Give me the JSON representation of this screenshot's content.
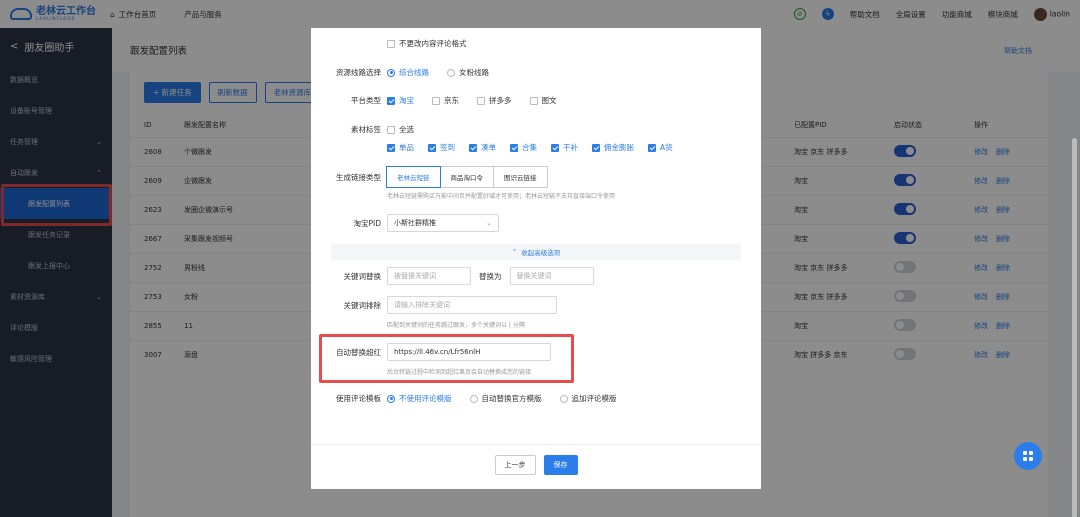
{
  "topbar": {
    "logo_main": "老林云工作台",
    "logo_sub": "LAOLINCLOUD",
    "nav_home": "工作台首页",
    "nav_products": "产品与服务",
    "help_docs": "帮助文档",
    "global_settings": "全局设置",
    "feature_mall": "功能商城",
    "module_mall": "模块商城",
    "username": "laolin"
  },
  "sidebar": {
    "title": "朋友圈助手",
    "items": [
      {
        "label": "数据概览"
      },
      {
        "label": "设备账号管理"
      },
      {
        "label": "任务管理",
        "arrow": "⌄"
      },
      {
        "label": "自动跟发",
        "arrow": "⌃"
      },
      {
        "label": "跟发配置列表"
      },
      {
        "label": "跟发任务记录"
      },
      {
        "label": "跟发上报中心"
      },
      {
        "label": "素材资源库",
        "arrow": "⌄"
      },
      {
        "label": "评论模版"
      },
      {
        "label": "敏感风险管理"
      }
    ]
  },
  "main": {
    "title": "跟发配置列表",
    "help": "帮助文档",
    "buttons": {
      "new_task": "+ 新建任务",
      "refresh": "刷新数据",
      "laolin": "老林资源库"
    },
    "table": {
      "headers": [
        "ID",
        "跟发配置名称",
        "",
        "已配置PID",
        "启动状态",
        "操作"
      ],
      "rows": [
        {
          "id": "2608",
          "name": "个微跟发",
          "pid": "淘宝 京东 拼多多",
          "on": true
        },
        {
          "id": "2609",
          "name": "企微跟发",
          "pid": "淘宝",
          "on": true
        },
        {
          "id": "2623",
          "name": "发圈企微演示号",
          "pid": "淘宝",
          "on": true
        },
        {
          "id": "2667",
          "name": "采集跟发视频号",
          "pid": "淘宝",
          "on": true
        },
        {
          "id": "2752",
          "name": "男粉线",
          "pid": "淘宝 京东 拼多多",
          "on": false
        },
        {
          "id": "2753",
          "name": "女粉",
          "pid": "淘宝 京东 拼多多",
          "on": false
        },
        {
          "id": "2855",
          "name": "11",
          "pid": "淘宝",
          "on": false
        },
        {
          "id": "3007",
          "name": "源盘",
          "pid": "淘宝 拼多多 京东",
          "on": false
        }
      ],
      "op_edit": "修改",
      "op_delete": "删除"
    }
  },
  "modal": {
    "no_change_comment": "不更改内容评论格式",
    "source_line": {
      "label": "资源线路选择",
      "options": [
        "综合线路",
        "女粉线路"
      ],
      "selected": "综合线路"
    },
    "platform": {
      "label": "平台类型",
      "options": [
        {
          "text": "淘宝",
          "checked": true
        },
        {
          "text": "京东",
          "checked": false
        },
        {
          "text": "拼多多",
          "checked": false
        },
        {
          "text": "图文",
          "checked": false
        }
      ]
    },
    "material": {
      "label": "素材标签",
      "select_all": "全选",
      "tags": [
        "单品",
        "签到",
        "凑单",
        "合集",
        "干补",
        "佣金膨胀",
        "A货"
      ]
    },
    "link_type": {
      "label": "生成链接类型",
      "options": [
        "老林云短链",
        "商品淘口令",
        "图识云链接"
      ],
      "selected": "老林云短链",
      "hint": "老林云短链需购买万能中间页并配置好域才可使用；老林云短链不支持直接端口令使用"
    },
    "taobao_pid": {
      "label": "淘宝PID",
      "value": "小斯社群精推"
    },
    "advanced": "收起高级选项",
    "keyword_replace": {
      "label": "关键词替换",
      "placeholder": "被替换关键词",
      "middle": "替换为",
      "placeholder2": "替换关键词"
    },
    "keyword_exclude": {
      "label": "关键词排除",
      "placeholder": "请输入排除关键词",
      "hint": "匹配到关键词的任务跳过跟发，多个关键词以 | 分隔"
    },
    "auto_replace": {
      "label": "自动替换超红",
      "value": "https://ll.46v.cn/Lfr56nlH",
      "hint": "后台转链过程中检测到超红果页会自动替换成您的链接"
    },
    "comment_template": {
      "label": "使用评论模板",
      "options": [
        "不使用评论模版",
        "自动替换官方模版",
        "追加评论模版"
      ],
      "selected": "不使用评论模版"
    },
    "prev": "上一步",
    "save": "保存"
  }
}
